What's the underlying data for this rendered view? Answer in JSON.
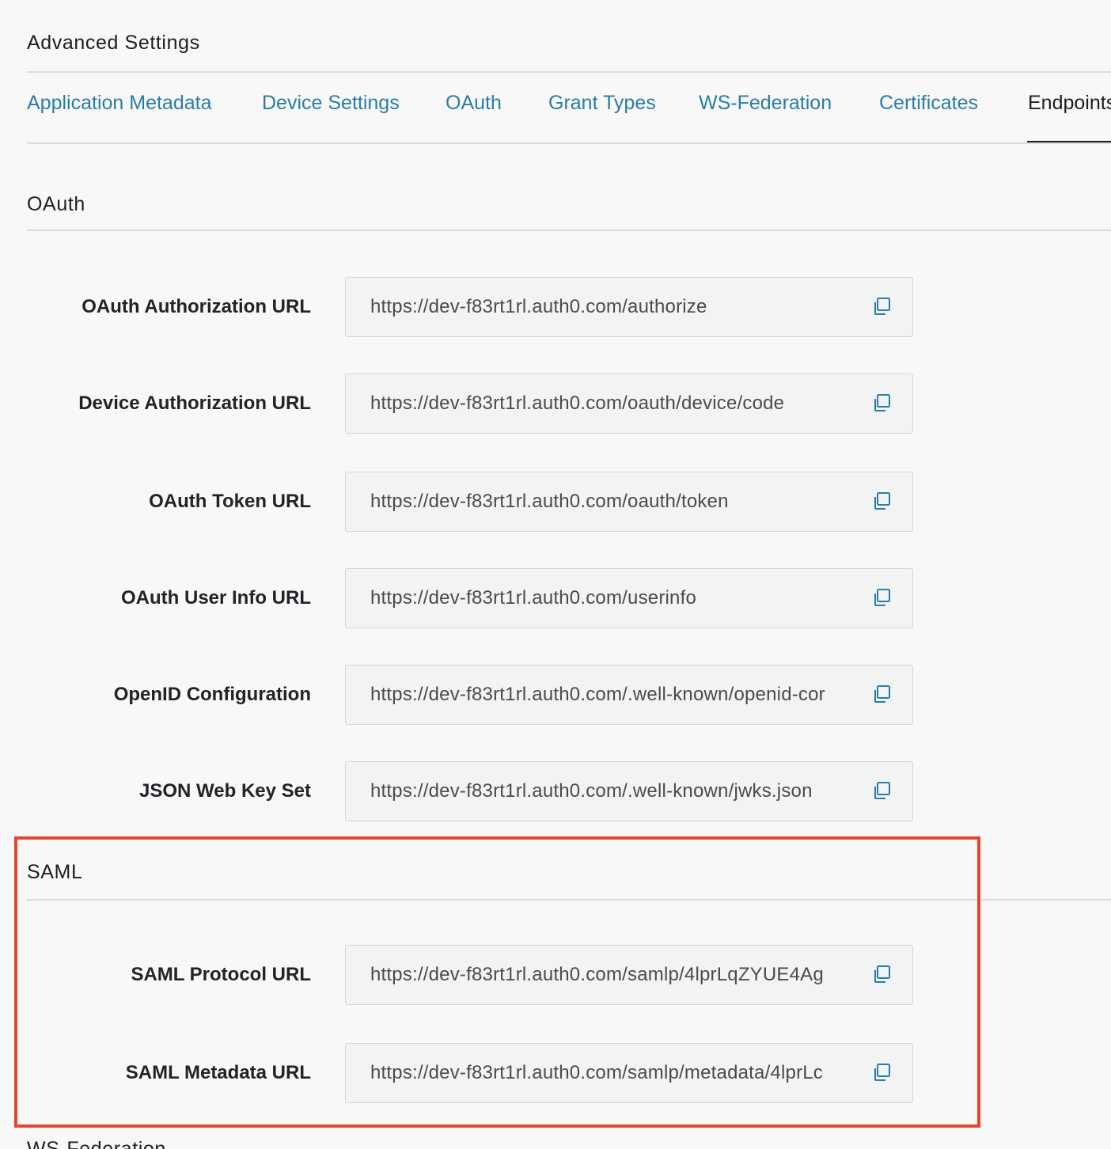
{
  "header": {
    "title": "Advanced Settings"
  },
  "tabs": [
    {
      "label": "Application Metadata",
      "active": false
    },
    {
      "label": "Device Settings",
      "active": false
    },
    {
      "label": "OAuth",
      "active": false
    },
    {
      "label": "Grant Types",
      "active": false
    },
    {
      "label": "WS-Federation",
      "active": false
    },
    {
      "label": "Certificates",
      "active": false
    },
    {
      "label": "Endpoints",
      "active": true
    }
  ],
  "oauth": {
    "title": "OAuth",
    "fields": [
      {
        "label": "OAuth Authorization URL",
        "value": "https://dev-f83rt1rl.auth0.com/authorize"
      },
      {
        "label": "Device Authorization URL",
        "value": "https://dev-f83rt1rl.auth0.com/oauth/device/code"
      },
      {
        "label": "OAuth Token URL",
        "value": "https://dev-f83rt1rl.auth0.com/oauth/token"
      },
      {
        "label": "OAuth User Info URL",
        "value": "https://dev-f83rt1rl.auth0.com/userinfo"
      },
      {
        "label": "OpenID Configuration",
        "value": "https://dev-f83rt1rl.auth0.com/.well-known/openid-cor"
      },
      {
        "label": "JSON Web Key Set",
        "value": "https://dev-f83rt1rl.auth0.com/.well-known/jwks.json"
      }
    ]
  },
  "saml": {
    "title": "SAML",
    "fields": [
      {
        "label": "SAML Protocol URL",
        "value": "https://dev-f83rt1rl.auth0.com/samlp/4lprLqZYUE4Ag"
      },
      {
        "label": "SAML Metadata URL",
        "value": "https://dev-f83rt1rl.auth0.com/samlp/metadata/4lprLc"
      }
    ]
  },
  "next_section": {
    "title": "WS-Federation"
  },
  "icons": {
    "copy": "copy-icon"
  },
  "colors": {
    "link": "#2a7da6",
    "text": "#1e1e22",
    "highlight": "#e5452d",
    "background": "#f8f8f8",
    "field_background": "#f2f3f3"
  }
}
